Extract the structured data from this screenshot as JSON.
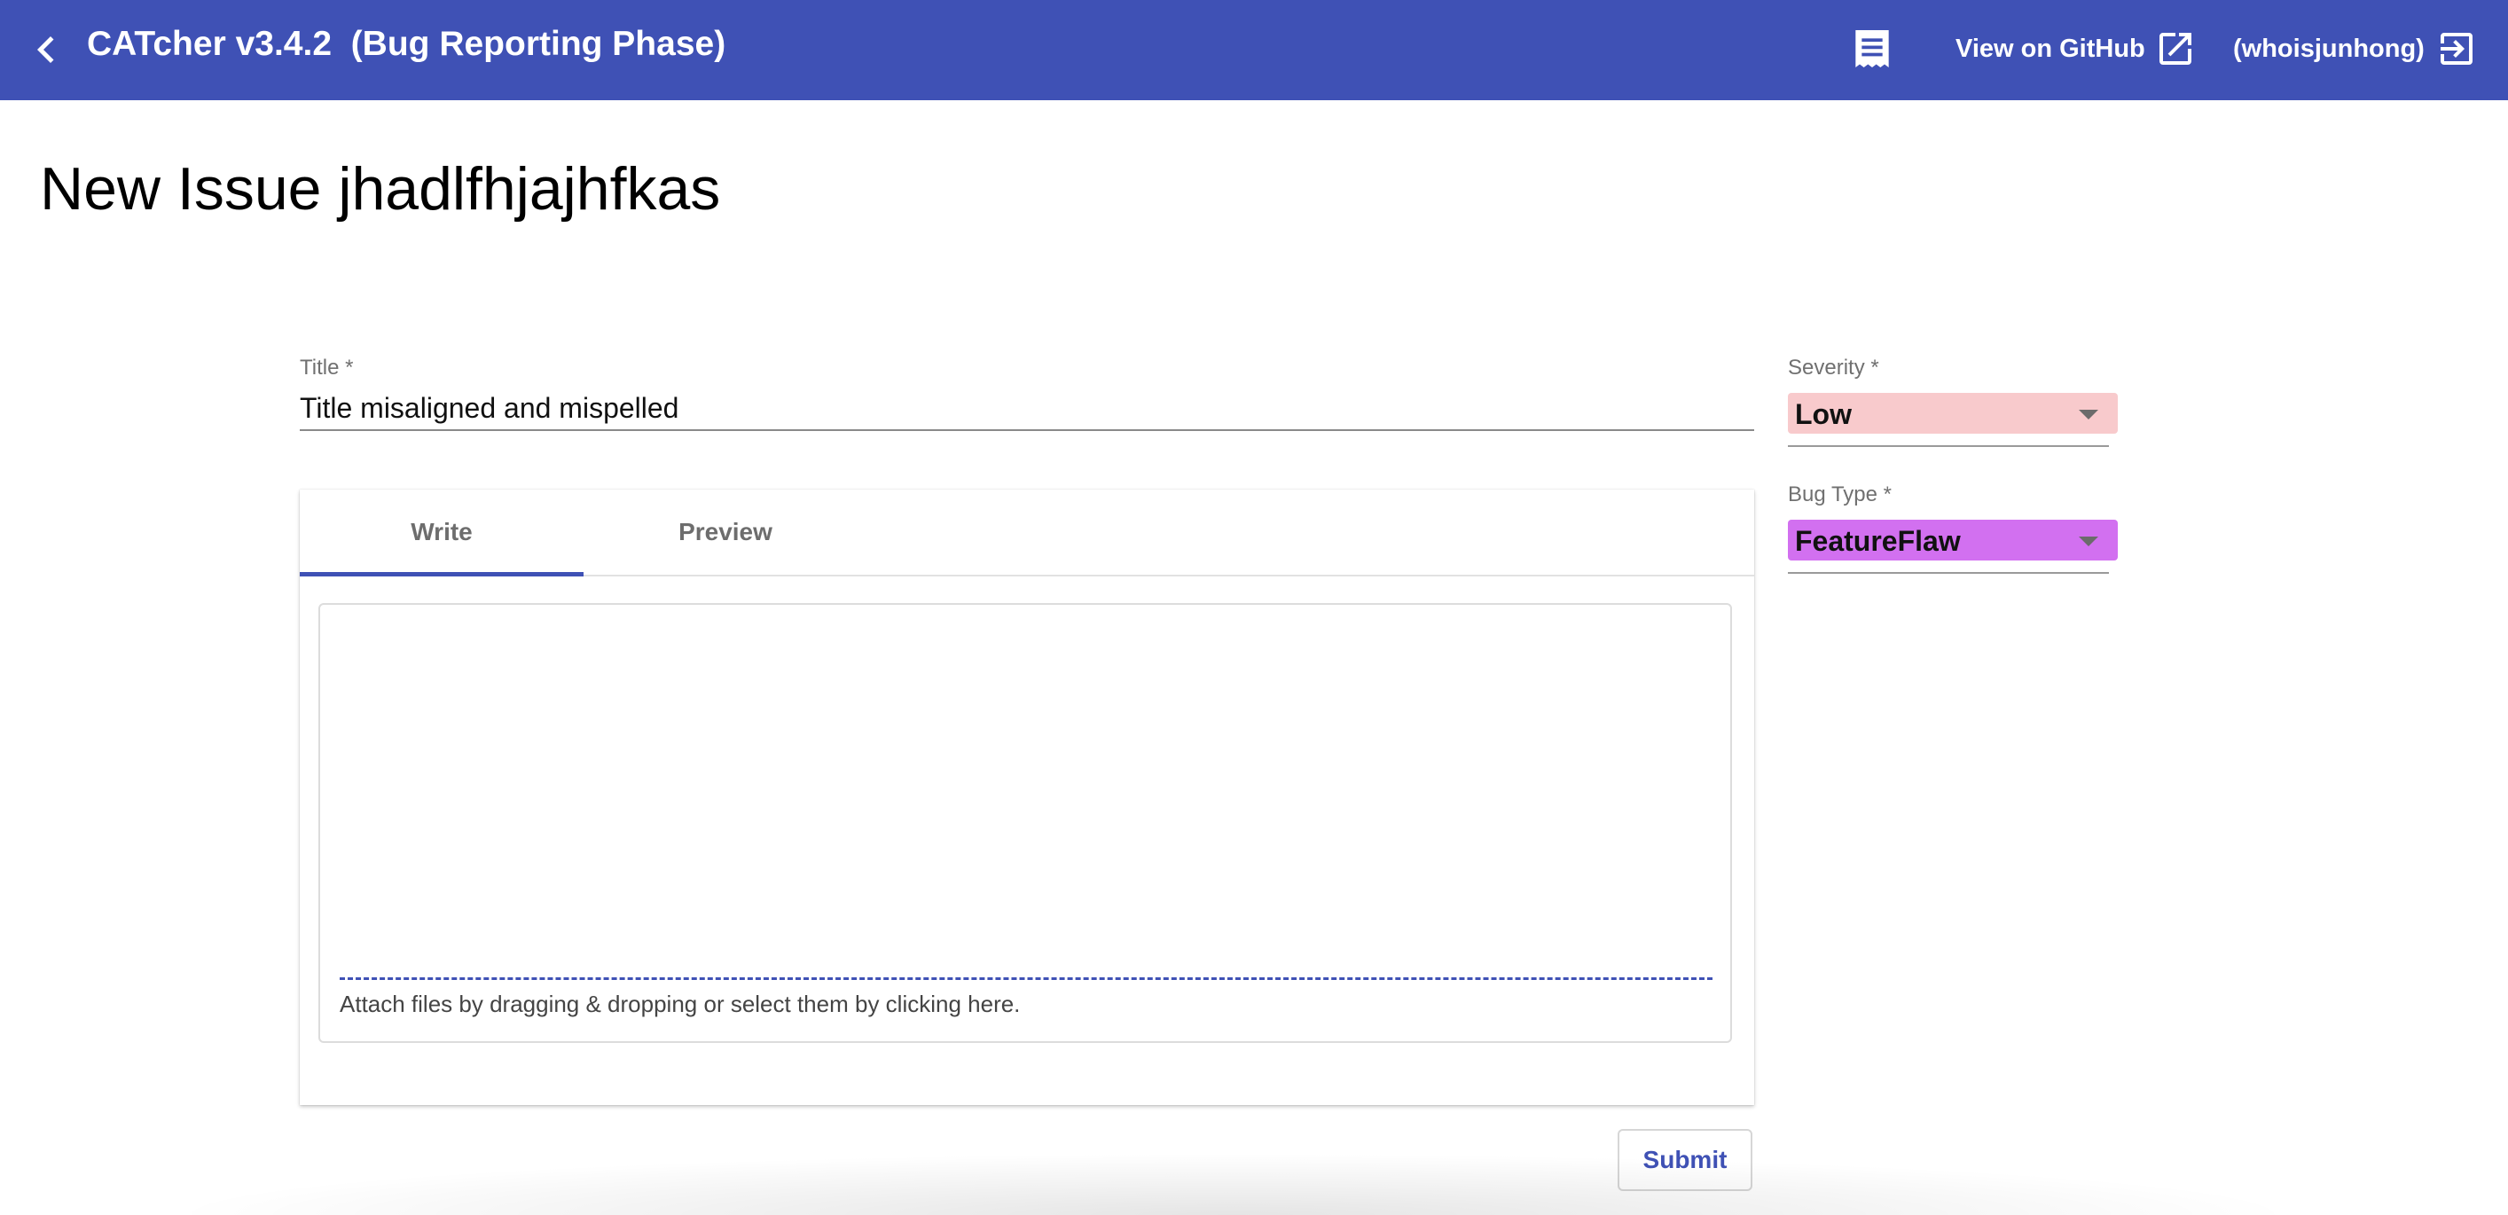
{
  "toolbar": {
    "back_icon": "chevron-left-icon",
    "title": "CATcher v3.4.2  (Bug Reporting Phase)",
    "session_icon": "session-list-icon",
    "github_label": "View on GitHub",
    "github_icon": "open-in-new-icon",
    "user_label": "(whoisjunhong)",
    "logout_icon": "logout-icon",
    "background_color": "#3f51b5"
  },
  "page": {
    "title": "New Issue jhadlfhjajhfkas"
  },
  "form": {
    "title_label": "Title *",
    "title_value": "Title misaligned and mispelled",
    "tabs": [
      {
        "label": "Write",
        "active": true
      },
      {
        "label": "Preview",
        "active": false
      }
    ],
    "description_value": "",
    "attach_text": "Attach files by dragging & dropping or select them by clicking here.",
    "submit_label": "Submit",
    "severity": {
      "label": "Severity *",
      "value": "Low",
      "color": "#f8cacc"
    },
    "bug_type": {
      "label": "Bug Type *",
      "value": "FeatureFlaw",
      "color": "#d270f0"
    }
  }
}
